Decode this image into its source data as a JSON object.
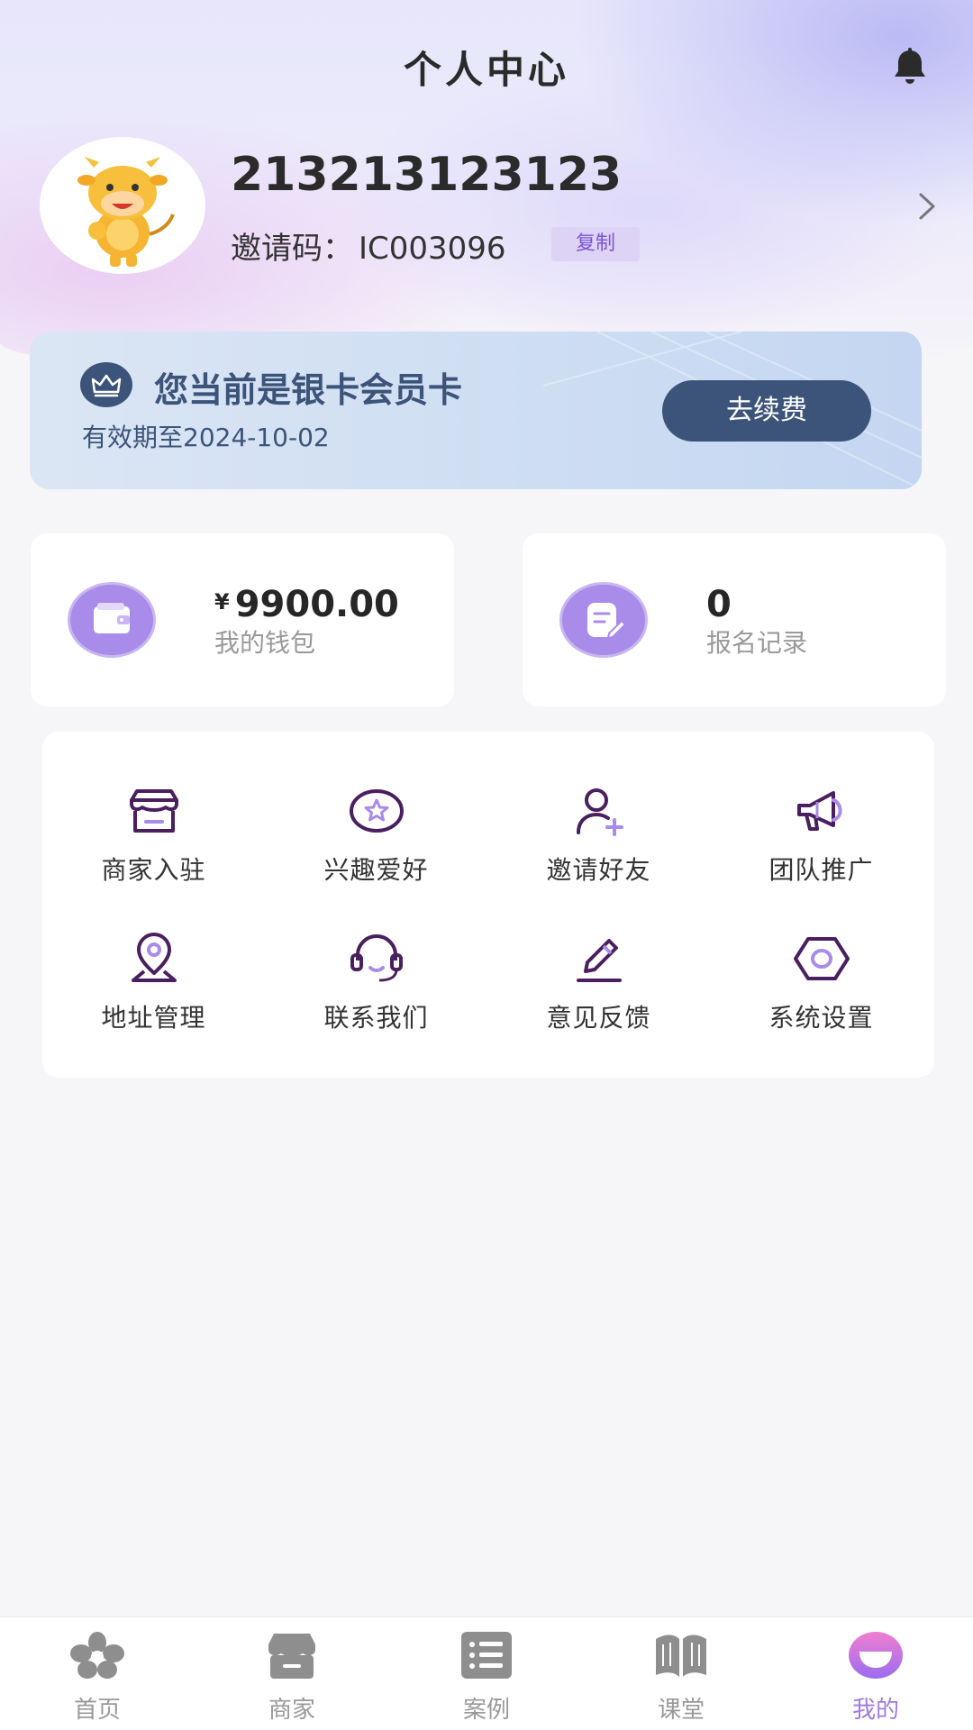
{
  "header": {
    "title": "个人中心",
    "bell_icon": "bell-icon"
  },
  "profile": {
    "username": "213213123123",
    "invite_label": "邀请码：",
    "invite_code": "IC003096",
    "copy_label": "复制",
    "avatar_icon": "cow-mascot-avatar"
  },
  "membership": {
    "title": "您当前是银卡会员卡",
    "expire": "有效期至2024-10-02",
    "renew_label": "去续费",
    "badge_icon": "crown-icon"
  },
  "stats": {
    "wallet": {
      "currency": "¥",
      "value": "9900.00",
      "label": "我的钱包",
      "icon": "wallet-icon"
    },
    "signup": {
      "value": "0",
      "label": "报名记录",
      "icon": "edit-note-icon"
    }
  },
  "menu": [
    {
      "label": "商家入驻",
      "icon": "store-icon"
    },
    {
      "label": "兴趣爱好",
      "icon": "star-badge-icon"
    },
    {
      "label": "邀请好友",
      "icon": "add-user-icon"
    },
    {
      "label": "团队推广",
      "icon": "megaphone-icon"
    },
    {
      "label": "地址管理",
      "icon": "location-pin-icon"
    },
    {
      "label": "联系我们",
      "icon": "headset-icon"
    },
    {
      "label": "意见反馈",
      "icon": "pencil-icon"
    },
    {
      "label": "系统设置",
      "icon": "hexagon-settings-icon"
    }
  ],
  "tabs": [
    {
      "label": "首页",
      "icon": "flower-icon",
      "active": false
    },
    {
      "label": "商家",
      "icon": "shop-icon",
      "active": false
    },
    {
      "label": "案例",
      "icon": "list-icon",
      "active": false
    },
    {
      "label": "课堂",
      "icon": "book-icon",
      "active": false
    },
    {
      "label": "我的",
      "icon": "profile-icon",
      "active": true
    }
  ],
  "colors": {
    "accent": "#a07ae0",
    "icon_purple": "#4a1f5f",
    "member_navy": "#3c5479",
    "copy_bg": "#ddd3f5",
    "stat_icon_bg": "#a98be9"
  }
}
